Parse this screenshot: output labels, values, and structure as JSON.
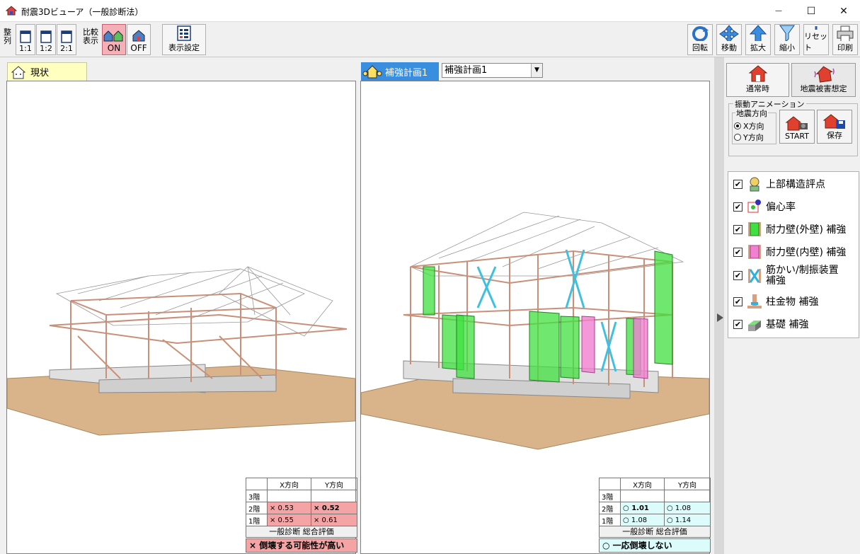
{
  "window": {
    "title": "耐震3Dビューア（一般診断法）",
    "minimize": "—",
    "maximize": "☐",
    "close": "✕"
  },
  "toolbar": {
    "arrange_label": "整列",
    "layout_1_1": "1:1",
    "layout_1_2": "1:2",
    "layout_2_1": "2:1",
    "compare_label": "比較表示",
    "compare_on": "ON",
    "compare_off": "OFF",
    "display_settings": "表示設定",
    "rotate": "回転",
    "move": "移動",
    "zoom_in": "拡大",
    "zoom_out": "縮小",
    "reset": "リセット",
    "print": "印刷"
  },
  "left_pane": {
    "tab_label": "現状",
    "results": {
      "col_x": "X方向",
      "col_y": "Y方向",
      "rows": [
        {
          "floor": "3階",
          "x": "",
          "y": ""
        },
        {
          "floor": "2階",
          "x": "× 0.53",
          "y": "× 0.52"
        },
        {
          "floor": "1階",
          "x": "× 0.55",
          "y": "× 0.61"
        }
      ],
      "eval_title": "一般診断 総合評価",
      "eval_result": "× 倒壊する可能性が高い"
    }
  },
  "right_pane": {
    "tab_label": "補強計画1",
    "plan_select": "補強計画1",
    "results": {
      "col_x": "X方向",
      "col_y": "Y方向",
      "rows": [
        {
          "floor": "3階",
          "x": "",
          "y": ""
        },
        {
          "floor": "2階",
          "x": "○ 1.01",
          "y": "○ 1.08"
        },
        {
          "floor": "1階",
          "x": "○ 1.08",
          "y": "○ 1.14"
        }
      ],
      "eval_title": "一般診断 総合評価",
      "eval_result": "○ 一応倒壊しない"
    }
  },
  "side": {
    "normal": "通常時",
    "quake": "地震被害想定",
    "anim_group": "振動アニメーション",
    "dir_group": "地震方向",
    "dir_x": "X方向",
    "dir_y": "Y方向",
    "start": "START",
    "save": "保存",
    "legend": [
      {
        "label": "上部構造評点",
        "icon": "inspector-icon"
      },
      {
        "label": "偏心率",
        "icon": "eccentricity-icon"
      },
      {
        "label": "耐力壁(外壁) 補強",
        "icon": "green-wall-icon"
      },
      {
        "label": "耐力壁(内壁) 補強",
        "icon": "pink-wall-icon"
      },
      {
        "label": "筋かい/制振装置",
        "label2": "補強",
        "icon": "brace-icon"
      },
      {
        "label": "柱金物 補強",
        "icon": "column-hardware-icon"
      },
      {
        "label": "基礎 補強",
        "icon": "foundation-icon"
      }
    ]
  },
  "colors": {
    "accent": "#3a8ee0",
    "fail": "#f4a4a4",
    "pass": "#dcfcfc",
    "green_wall": "#40e040",
    "pink_wall": "#f080d0",
    "ground": "#d9b48a",
    "timber": "#e8b89a"
  }
}
